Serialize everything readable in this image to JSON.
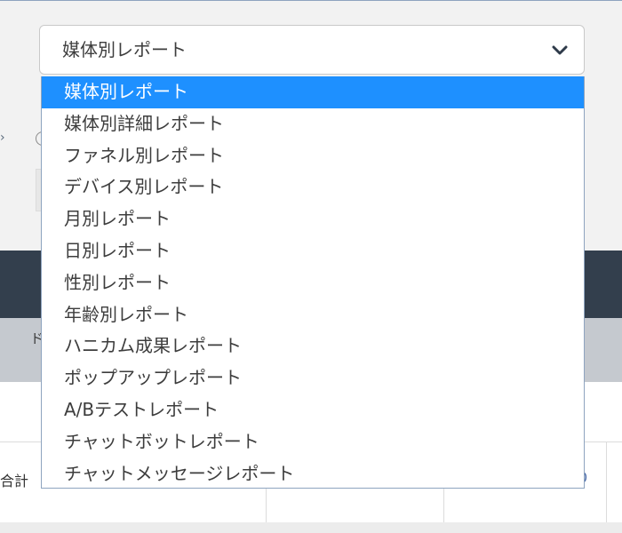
{
  "select": {
    "value": "媒体別レポート",
    "chevron_icon": "chevron-down-icon"
  },
  "dropdown": {
    "selected_index": 0,
    "selected_color": "#1e90ff",
    "options": [
      "媒体別レポート",
      "媒体別詳細レポート",
      "ファネル別レポート",
      "デバイス別レポート",
      "月別レポート",
      "日別レポート",
      "性別レポート",
      "年齢別レポート",
      "ハニカム成果レポート",
      "ポップアップレポート",
      "A/Bテストレポート",
      "チャットボットレポート",
      "チャットメッセージレポート"
    ]
  },
  "background": {
    "gray_band_char": "ド",
    "total_label": "合計",
    "right_fragment": "0",
    "left_chevron": "›"
  }
}
